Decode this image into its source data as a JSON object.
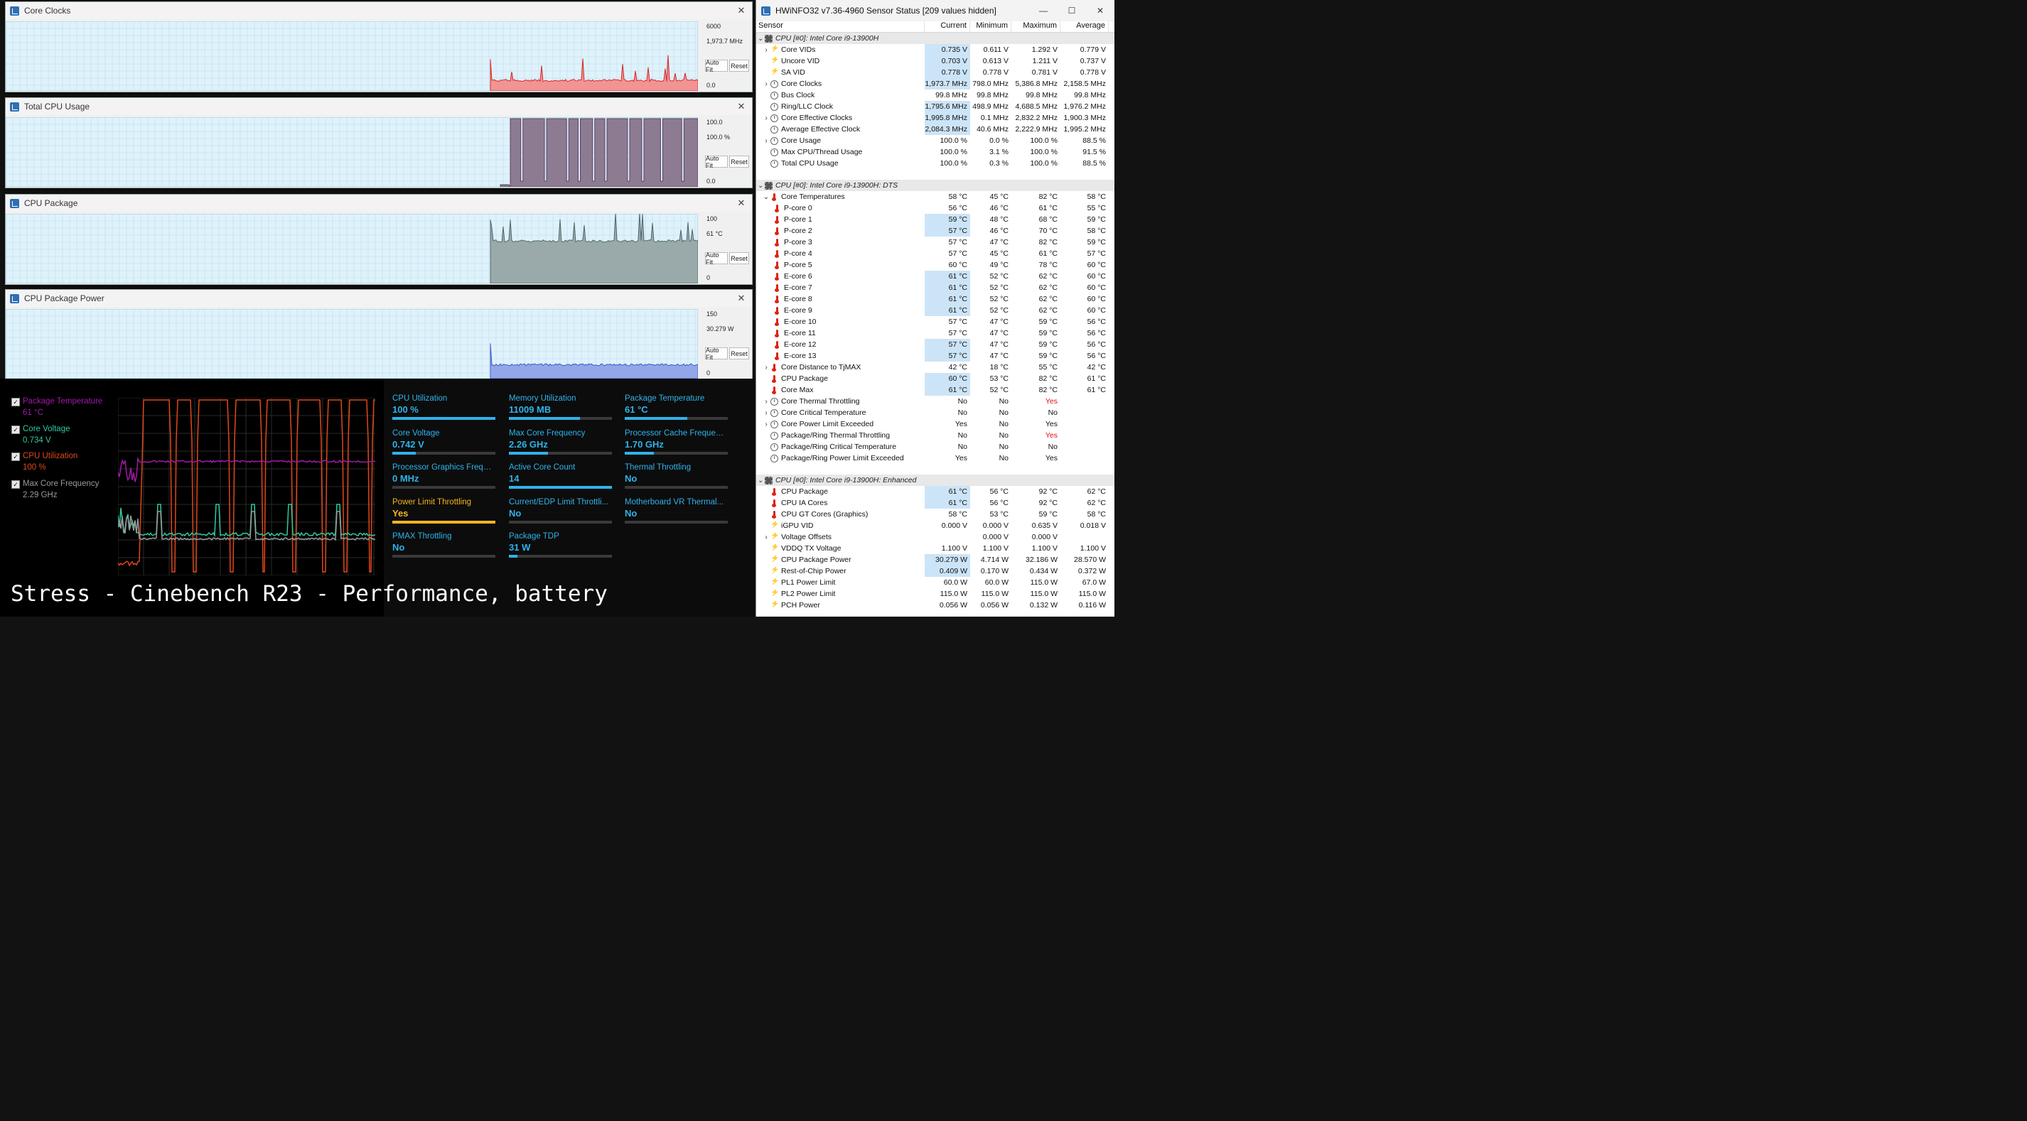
{
  "graphs": [
    {
      "title": "Core Clocks",
      "scale_max": "6000",
      "current": "1,973.7 MHz",
      "scale_min": "0.0",
      "auto_fit": "Auto Fit",
      "reset": "Reset",
      "color": "#f29494",
      "stroke": "#d42a2a",
      "type": "spiky",
      "baseline": 0.15,
      "start": 0.7
    },
    {
      "title": "Total CPU Usage",
      "scale_max": "100.0",
      "current": "100.0 %",
      "scale_min": "0.0",
      "auto_fit": "Auto Fit",
      "reset": "Reset",
      "color": "#8c7b91",
      "stroke": "#5c3f66",
      "type": "square",
      "baseline": 1.0,
      "start": 0.715
    },
    {
      "title": "CPU Package",
      "scale_max": "100",
      "current": "61 °C",
      "scale_min": "0",
      "auto_fit": "Auto Fit",
      "reset": "Reset",
      "color": "#9aa9a9",
      "stroke": "#4e6a6e",
      "type": "spiky",
      "baseline": 0.61,
      "start": 0.7
    },
    {
      "title": "CPU Package Power",
      "scale_max": "150",
      "current": "30.279 W",
      "scale_min": "0",
      "auto_fit": "Auto Fit",
      "reset": "Reset",
      "color": "#93a7e8",
      "stroke": "#3a59c9",
      "type": "flat",
      "baseline": 0.2,
      "start": 0.7
    }
  ],
  "legend": [
    {
      "name": "Package Temperature",
      "value": "61 °C",
      "color": "#a01aa8",
      "checked": "✓"
    },
    {
      "name": "Core Voltage",
      "value": "0.734 V",
      "color": "#2ec9a2",
      "checked": "✓"
    },
    {
      "name": "CPU Utilization",
      "value": "100 %",
      "color": "#e0481a",
      "checked": "✓"
    },
    {
      "name": "Max Core Frequency",
      "value": "2.29 GHz",
      "color": "#9a9a9a",
      "checked": "✓"
    }
  ],
  "tiles": [
    {
      "label": "CPU Utilization",
      "value": "100 %",
      "fill": 1.0
    },
    {
      "label": "Memory Utilization",
      "value": "11009  MB",
      "fill": 0.69
    },
    {
      "label": "Package Temperature",
      "value": "61 °C",
      "fill": 0.61
    },
    {
      "label": "Core Voltage",
      "value": "0.742 V",
      "fill": 0.23
    },
    {
      "label": "Max Core Frequency",
      "value": "2.26 GHz",
      "fill": 0.38
    },
    {
      "label": "Processor Cache Frequency",
      "value": "1.70 GHz",
      "fill": 0.28
    },
    {
      "label": "Processor Graphics Freque...",
      "value": "0 MHz",
      "fill": 0.0
    },
    {
      "label": "Active Core Count",
      "value": "14",
      "fill": 1.0
    },
    {
      "label": "Thermal Throttling",
      "value": "No",
      "fill": 0.0
    },
    {
      "label": "Power Limit Throttling",
      "value": "Yes",
      "fill": 1.0,
      "warn": true
    },
    {
      "label": "Current/EDP Limit Throttli...",
      "value": "No",
      "fill": 0.0
    },
    {
      "label": "Motherboard VR Thermal...",
      "value": "No",
      "fill": 0.0
    },
    {
      "label": "PMAX Throttling",
      "value": "No",
      "fill": 0.0
    },
    {
      "label": "Package TDP",
      "value": "31 W",
      "fill": 0.08
    }
  ],
  "caption": "Stress - Cinebench R23 - Performance, battery",
  "hw": {
    "title": "HWiNFO32 v7.36-4960 Sensor Status [209 values hidden]",
    "columns": [
      "Sensor",
      "Current",
      "Minimum",
      "Maximum",
      "Average"
    ],
    "rows": [
      {
        "g": "CPU [#0]: Intel Core i9-13900H"
      },
      {
        "e": ">",
        "i": "bolt",
        "n": "Core VIDs",
        "v": [
          "0.735 V",
          "0.611 V",
          "1.292 V",
          "0.779 V"
        ],
        "h": 1,
        "ind": 1
      },
      {
        "i": "bolt",
        "n": "Uncore VID",
        "v": [
          "0.703 V",
          "0.613 V",
          "1.211 V",
          "0.737 V"
        ],
        "h": 1
      },
      {
        "i": "bolt",
        "n": "SA VID",
        "v": [
          "0.778 V",
          "0.778 V",
          "0.781 V",
          "0.778 V"
        ],
        "h": 1
      },
      {
        "e": ">",
        "i": "clk",
        "n": "Core Clocks",
        "v": [
          "1,973.7 MHz",
          "798.0 MHz",
          "5,386.8 MHz",
          "2,158.5 MHz"
        ],
        "h": 1,
        "ind": 1
      },
      {
        "i": "clk",
        "n": "Bus Clock",
        "v": [
          "99.8 MHz",
          "99.8 MHz",
          "99.8 MHz",
          "99.8 MHz"
        ]
      },
      {
        "i": "clk",
        "n": "Ring/LLC Clock",
        "v": [
          "1,795.6 MHz",
          "498.9 MHz",
          "4,688.5 MHz",
          "1,976.2 MHz"
        ],
        "h": 1
      },
      {
        "e": ">",
        "i": "clk",
        "n": "Core Effective Clocks",
        "v": [
          "1,995.8 MHz",
          "0.1 MHz",
          "2,832.2 MHz",
          "1,900.3 MHz"
        ],
        "h": 1,
        "ind": 1
      },
      {
        "i": "clk",
        "n": "Average Effective Clock",
        "v": [
          "2,084.3 MHz",
          "40.6 MHz",
          "2,222.9 MHz",
          "1,995.2 MHz"
        ],
        "h": 1
      },
      {
        "e": ">",
        "i": "clk",
        "n": "Core Usage",
        "v": [
          "100.0 %",
          "0.0 %",
          "100.0 %",
          "88.5 %"
        ],
        "ind": 1
      },
      {
        "i": "clk",
        "n": "Max CPU/Thread Usage",
        "v": [
          "100.0 %",
          "3.1 %",
          "100.0 %",
          "91.5 %"
        ]
      },
      {
        "i": "clk",
        "n": "Total CPU Usage",
        "v": [
          "100.0 %",
          "0.3 %",
          "100.0 %",
          "88.5 %"
        ]
      },
      {
        "blank": 1
      },
      {
        "g": "CPU [#0]: Intel Core i9-13900H: DTS"
      },
      {
        "e": "v",
        "i": "thm",
        "n": "Core Temperatures",
        "v": [
          "58 °C",
          "45 °C",
          "82 °C",
          "58 °C"
        ],
        "ind": 1
      },
      {
        "i": "thm",
        "n": "P-core 0",
        "v": [
          "56 °C",
          "46 °C",
          "61 °C",
          "55 °C"
        ],
        "ind": 2
      },
      {
        "i": "thm",
        "n": "P-core 1",
        "v": [
          "59 °C",
          "48 °C",
          "68 °C",
          "59 °C"
        ],
        "h": 1,
        "ind": 2
      },
      {
        "i": "thm",
        "n": "P-core 2",
        "v": [
          "57 °C",
          "46 °C",
          "70 °C",
          "58 °C"
        ],
        "h": 1,
        "ind": 2
      },
      {
        "i": "thm",
        "n": "P-core 3",
        "v": [
          "57 °C",
          "47 °C",
          "82 °C",
          "59 °C"
        ],
        "ind": 2
      },
      {
        "i": "thm",
        "n": "P-core 4",
        "v": [
          "57 °C",
          "45 °C",
          "61 °C",
          "57 °C"
        ],
        "ind": 2
      },
      {
        "i": "thm",
        "n": "P-core 5",
        "v": [
          "60 °C",
          "49 °C",
          "78 °C",
          "60 °C"
        ],
        "ind": 2
      },
      {
        "i": "thm",
        "n": "E-core 6",
        "v": [
          "61 °C",
          "52 °C",
          "62 °C",
          "60 °C"
        ],
        "h": 1,
        "ind": 2
      },
      {
        "i": "thm",
        "n": "E-core 7",
        "v": [
          "61 °C",
          "52 °C",
          "62 °C",
          "60 °C"
        ],
        "h": 1,
        "ind": 2
      },
      {
        "i": "thm",
        "n": "E-core 8",
        "v": [
          "61 °C",
          "52 °C",
          "62 °C",
          "60 °C"
        ],
        "h": 1,
        "ind": 2
      },
      {
        "i": "thm",
        "n": "E-core 9",
        "v": [
          "61 °C",
          "52 °C",
          "62 °C",
          "60 °C"
        ],
        "h": 1,
        "ind": 2
      },
      {
        "i": "thm",
        "n": "E-core 10",
        "v": [
          "57 °C",
          "47 °C",
          "59 °C",
          "56 °C"
        ],
        "ind": 2
      },
      {
        "i": "thm",
        "n": "E-core 11",
        "v": [
          "57 °C",
          "47 °C",
          "59 °C",
          "56 °C"
        ],
        "ind": 2
      },
      {
        "i": "thm",
        "n": "E-core 12",
        "v": [
          "57 °C",
          "47 °C",
          "59 °C",
          "56 °C"
        ],
        "h": 1,
        "ind": 2
      },
      {
        "i": "thm",
        "n": "E-core 13",
        "v": [
          "57 °C",
          "47 °C",
          "59 °C",
          "56 °C"
        ],
        "h": 1,
        "ind": 2
      },
      {
        "e": ">",
        "i": "thm",
        "n": "Core Distance to TjMAX",
        "v": [
          "42 °C",
          "18 °C",
          "55 °C",
          "42 °C"
        ],
        "ind": 1
      },
      {
        "i": "thm",
        "n": "CPU Package",
        "v": [
          "60 °C",
          "53 °C",
          "82 °C",
          "61 °C"
        ],
        "h": 1
      },
      {
        "i": "thm",
        "n": "Core Max",
        "v": [
          "61 °C",
          "52 °C",
          "82 °C",
          "61 °C"
        ],
        "h": 1
      },
      {
        "e": ">",
        "i": "clk",
        "n": "Core Thermal Throttling",
        "v": [
          "No",
          "No",
          "Yes",
          ""
        ],
        "r": 2,
        "ind": 1
      },
      {
        "e": ">",
        "i": "clk",
        "n": "Core Critical Temperature",
        "v": [
          "No",
          "No",
          "No",
          ""
        ],
        "ind": 1
      },
      {
        "e": ">",
        "i": "clk",
        "n": "Core Power Limit Exceeded",
        "v": [
          "Yes",
          "No",
          "Yes",
          ""
        ],
        "ind": 1
      },
      {
        "i": "clk",
        "n": "Package/Ring Thermal Throttling",
        "v": [
          "No",
          "No",
          "Yes",
          ""
        ],
        "r": 2
      },
      {
        "i": "clk",
        "n": "Package/Ring Critical Temperature",
        "v": [
          "No",
          "No",
          "No",
          ""
        ]
      },
      {
        "i": "clk",
        "n": "Package/Ring Power Limit Exceeded",
        "v": [
          "Yes",
          "No",
          "Yes",
          ""
        ]
      },
      {
        "blank": 1
      },
      {
        "g": "CPU [#0]: Intel Core i9-13900H: Enhanced"
      },
      {
        "i": "thm",
        "n": "CPU Package",
        "v": [
          "61 °C",
          "56 °C",
          "92 °C",
          "62 °C"
        ],
        "h": 1
      },
      {
        "i": "thm",
        "n": "CPU IA Cores",
        "v": [
          "61 °C",
          "56 °C",
          "92 °C",
          "62 °C"
        ],
        "h": 1
      },
      {
        "i": "thm",
        "n": "CPU GT Cores (Graphics)",
        "v": [
          "58 °C",
          "53 °C",
          "59 °C",
          "58 °C"
        ]
      },
      {
        "i": "bolt",
        "n": "iGPU VID",
        "v": [
          "0.000 V",
          "0.000 V",
          "0.635 V",
          "0.018 V"
        ]
      },
      {
        "e": ">",
        "i": "bolt",
        "n": "Voltage Offsets",
        "v": [
          "",
          "0.000 V",
          "0.000 V",
          ""
        ],
        "ind": 1
      },
      {
        "i": "bolt",
        "n": "VDDQ TX Voltage",
        "v": [
          "1.100 V",
          "1.100 V",
          "1.100 V",
          "1.100 V"
        ]
      },
      {
        "i": "bolt",
        "n": "CPU Package Power",
        "v": [
          "30.279 W",
          "4.714 W",
          "32.186 W",
          "28.570 W"
        ],
        "h": 1
      },
      {
        "i": "bolt",
        "n": "Rest-of-Chip Power",
        "v": [
          "0.409 W",
          "0.170 W",
          "0.434 W",
          "0.372 W"
        ],
        "h": 1
      },
      {
        "i": "bolt",
        "n": "PL1 Power Limit",
        "v": [
          "60.0 W",
          "60.0 W",
          "115.0 W",
          "67.0 W"
        ]
      },
      {
        "i": "bolt",
        "n": "PL2 Power Limit",
        "v": [
          "115.0 W",
          "115.0 W",
          "115.0 W",
          "115.0 W"
        ]
      },
      {
        "i": "bolt",
        "n": "PCH Power",
        "v": [
          "0.056 W",
          "0.056 W",
          "0.132 W",
          "0.116 W"
        ]
      }
    ]
  }
}
